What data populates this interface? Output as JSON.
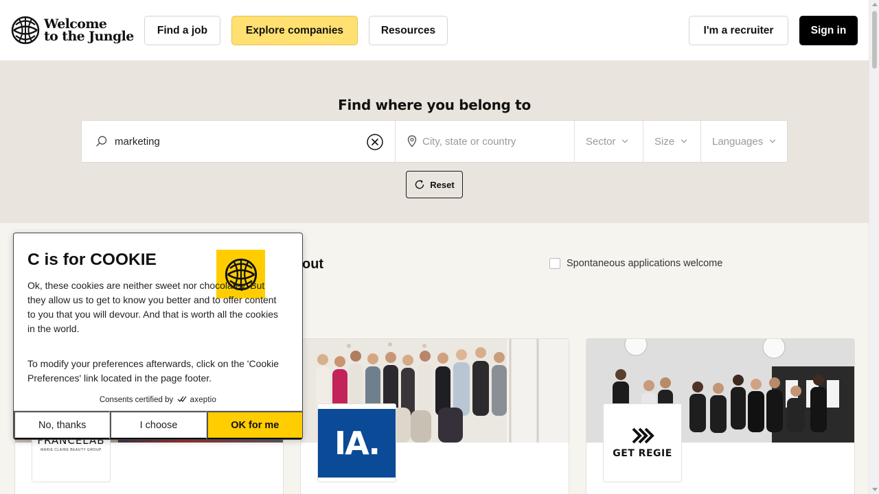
{
  "header": {
    "logo_line1": "Welcome",
    "logo_line2": "to the Jungle",
    "nav": {
      "find_job": "Find a job",
      "explore": "Explore companies",
      "resources": "Resources"
    },
    "recruiter": "I'm a recruiter",
    "sign_in": "Sign in"
  },
  "hero": {
    "title": "Find where you belong to",
    "search_value": "marketing",
    "location_placeholder": "City, state or country",
    "filters": {
      "sector": "Sector",
      "size": "Size",
      "languages": "Languages"
    },
    "reset": "Reset"
  },
  "results": {
    "title_fragment": "out",
    "spontaneous": "Spontaneous applications welcome",
    "cards": [
      {
        "logo_text": "FRANCELAB",
        "logo_sub": "MARIE CLAIRE BEAUTY GROUP"
      },
      {
        "logo_text": "IA."
      },
      {
        "logo_text": "GET REGIE"
      }
    ]
  },
  "cookie": {
    "title": "C is for COOKIE",
    "p1": "Ok, these cookies are neither sweet nor chocolatey. But they allow us to get to know you better and to offer content to you that you will devour. And that is worth all the cookies in the world.",
    "p2": "To modify your preferences afterwards, click on the 'Cookie Preferences' link located in the page footer.",
    "certified": "Consents certified by",
    "certified_brand": "axeptio",
    "btn_no": "No, thanks",
    "btn_choose": "I choose",
    "btn_ok": "OK for me"
  },
  "colors": {
    "accent_yellow": "#ffe071",
    "cookie_yellow": "#ffcd00",
    "hero_bg": "#e9e5de",
    "ia_blue": "#0a4a97"
  }
}
